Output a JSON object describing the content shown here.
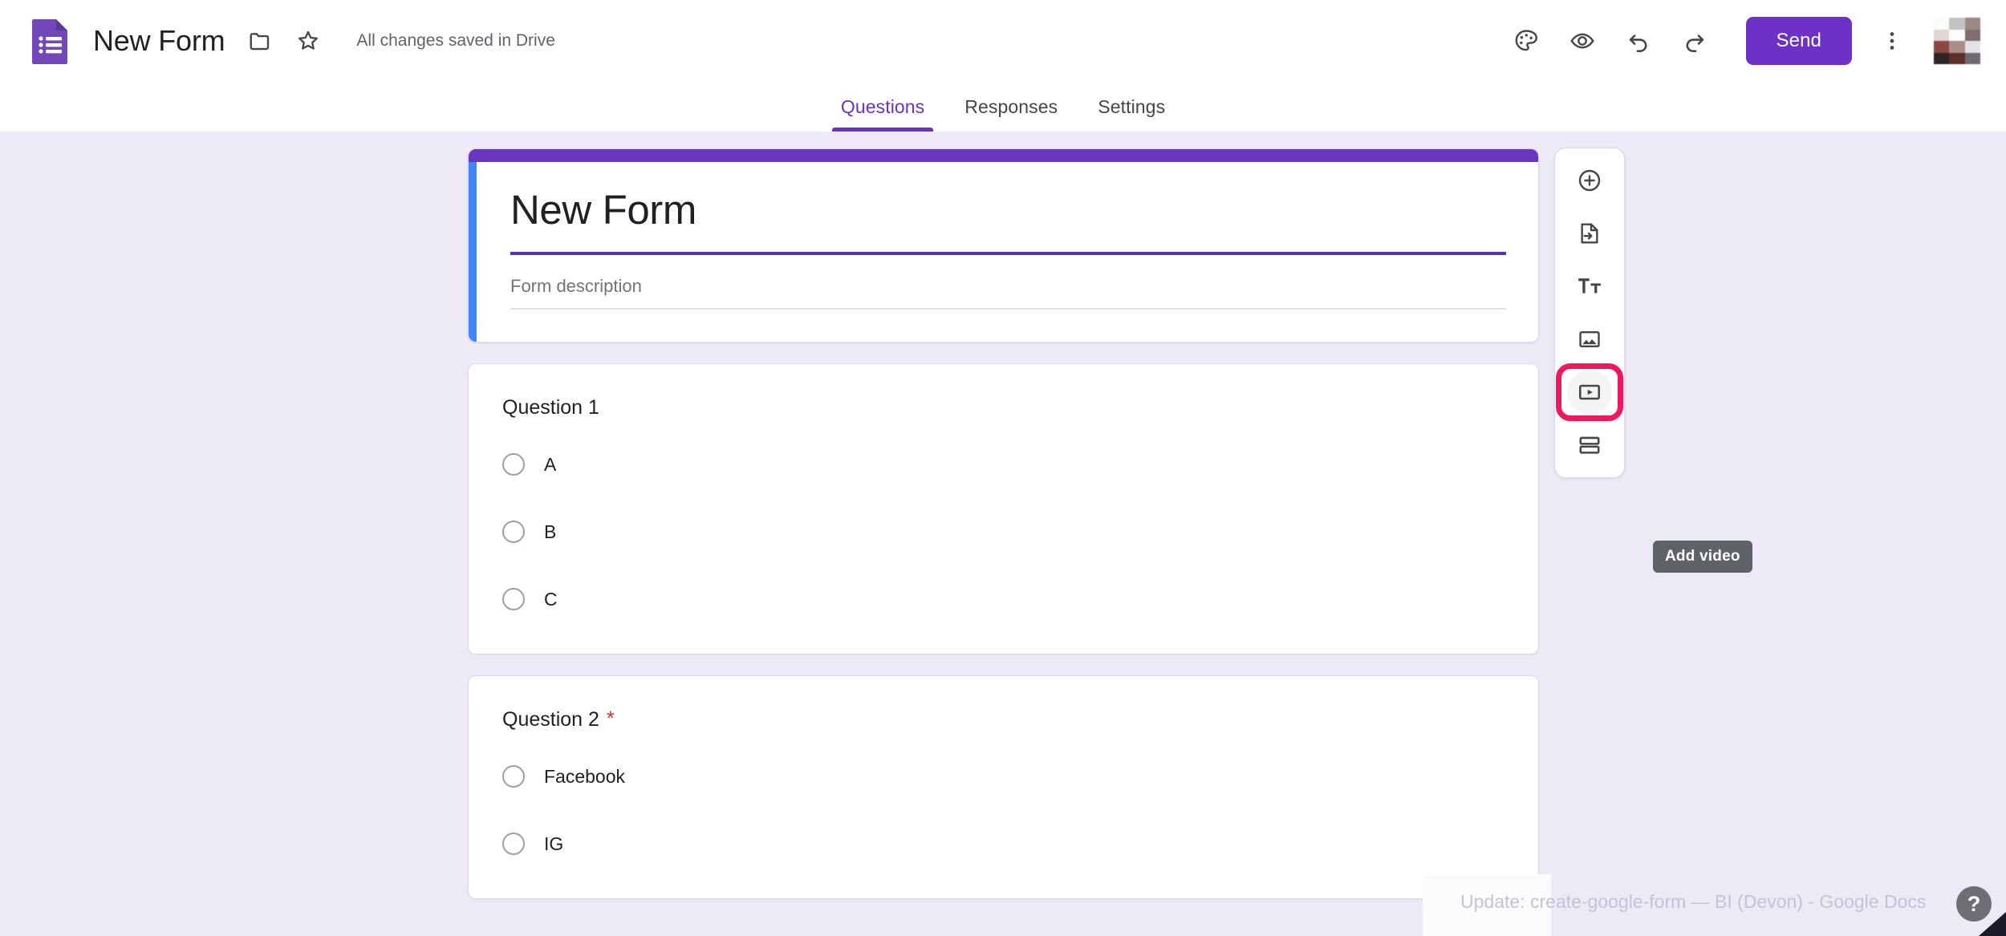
{
  "app": {
    "logo_icon": "google-forms-logo-icon",
    "doc_title": "New Form",
    "move_icon": "folder-icon",
    "star_icon": "star-outline-icon",
    "save_status": "All changes saved in Drive"
  },
  "toolbar": {
    "theme_icon": "palette-icon",
    "preview_icon": "eye-preview-icon",
    "undo_icon": "undo-icon",
    "redo_icon": "redo-icon",
    "send_label": "Send",
    "more_icon": "kebab-menu-icon",
    "avatar_icon": "user-avatar",
    "accent_color": "#6D31C7"
  },
  "tabs": [
    {
      "label": "Questions",
      "active": true
    },
    {
      "label": "Responses",
      "active": false
    },
    {
      "label": "Settings",
      "active": false
    }
  ],
  "form_header": {
    "title": "New Form",
    "description_placeholder": "Form description",
    "top_bar_color": "#6B36BE",
    "left_accent_color": "#4285F4",
    "title_underline_color": "#5A32B4"
  },
  "questions": [
    {
      "title": "Question 1",
      "required": false,
      "required_marker": "*",
      "type": "radio",
      "options": [
        "A",
        "B",
        "C"
      ]
    },
    {
      "title": "Question 2",
      "required": true,
      "required_marker": "*",
      "type": "radio",
      "options": [
        "Facebook",
        "IG"
      ]
    }
  ],
  "side_toolbar": {
    "items": [
      {
        "icon": "add-question-icon",
        "label": "Add question",
        "highlighted": false
      },
      {
        "icon": "import-questions-icon",
        "label": "Import questions",
        "highlighted": false
      },
      {
        "icon": "add-title-description-icon",
        "label": "Add title and description",
        "highlighted": false
      },
      {
        "icon": "add-image-icon",
        "label": "Add image",
        "highlighted": false
      },
      {
        "icon": "add-video-icon",
        "label": "Add video",
        "highlighted": true
      },
      {
        "icon": "add-section-icon",
        "label": "Add section",
        "highlighted": false
      }
    ],
    "highlight_color": "#F0185C",
    "visible_tooltip": "Add video"
  },
  "bottom_overlay": {
    "text": "Update: create-google-form — BI (Devon) - Google Docs",
    "help_label": "?",
    "help_icon": "help-question-icon"
  },
  "avatar_tiles": [
    "#fbfbfb",
    "#c3c3c6",
    "#9c8884",
    "#e0d6d4",
    "#fbfbfb",
    "#7e6f6e",
    "#8d4740",
    "#ab8d8b",
    "#e4e4e8",
    "#2d2526",
    "#5d302a",
    "#706a70",
    "#ffffff",
    "#9d9d9f",
    "#5d534f",
    "#b2babb"
  ]
}
